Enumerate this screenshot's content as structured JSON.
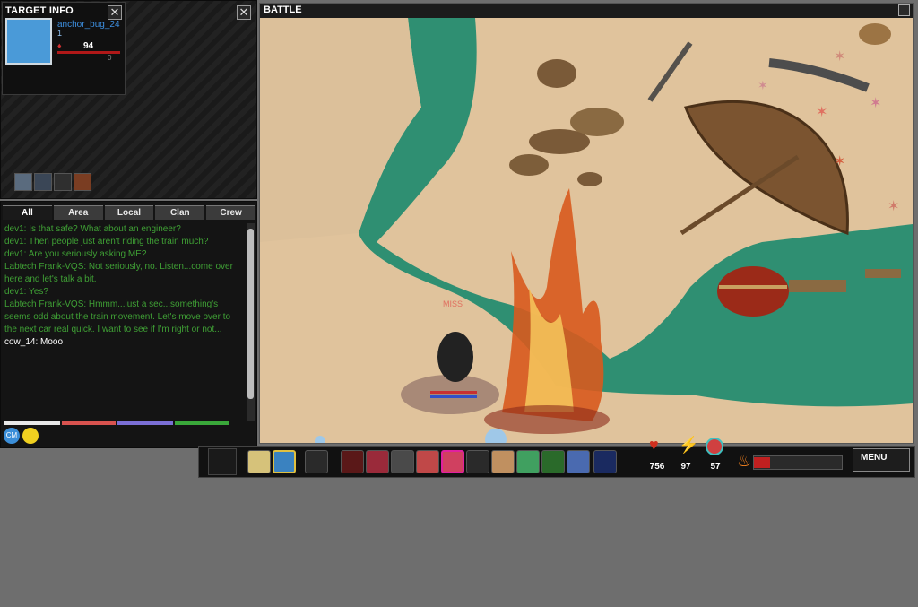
{
  "target_info": {
    "title": "TARGET INFO",
    "name": "anchor_bug_24",
    "level": "1",
    "hp": "94",
    "small_text": "0"
  },
  "chat": {
    "tabs": [
      "All",
      "Area",
      "Local",
      "Clan",
      "Crew"
    ],
    "active_tab": "All",
    "messages": [
      {
        "text": "dev1: Is that safe? What about an engineer?",
        "color": "#3fa035"
      },
      {
        "text": "dev1: Then people just aren't riding the train much?",
        "color": "#3fa035"
      },
      {
        "text": "dev1: Are you seriously asking ME?",
        "color": "#3fa035"
      },
      {
        "text": "Labtech Frank-VQS: Not seriously, no. Listen...come over here and let's talk a bit.",
        "color": "#3fa035"
      },
      {
        "text": "dev1: Yes?",
        "color": "#3fa035"
      },
      {
        "text": "Labtech Frank-VQS: Hmmm...just a sec...something's seems odd about the train movement. Let's move over to the next car real quick. I want to see if I'm right or not...",
        "color": "#3fa035"
      },
      {
        "text": "cow_14: Mooo",
        "color": "#ffffff"
      }
    ],
    "channel_colors": [
      "#e8e8e8",
      "#d9534f",
      "#7b6fd6",
      "#3aa83a"
    ]
  },
  "battle": {
    "title": "BATTLE",
    "miss_text": "MISS"
  },
  "action_bar": {
    "health": "756",
    "energy": "97",
    "shield": "57",
    "menu_label": "MENU"
  },
  "colors": {
    "sand": "#e2c6a0",
    "water": "#2f8f72",
    "health": "#d0301f",
    "energy": "#2f7ad8"
  }
}
